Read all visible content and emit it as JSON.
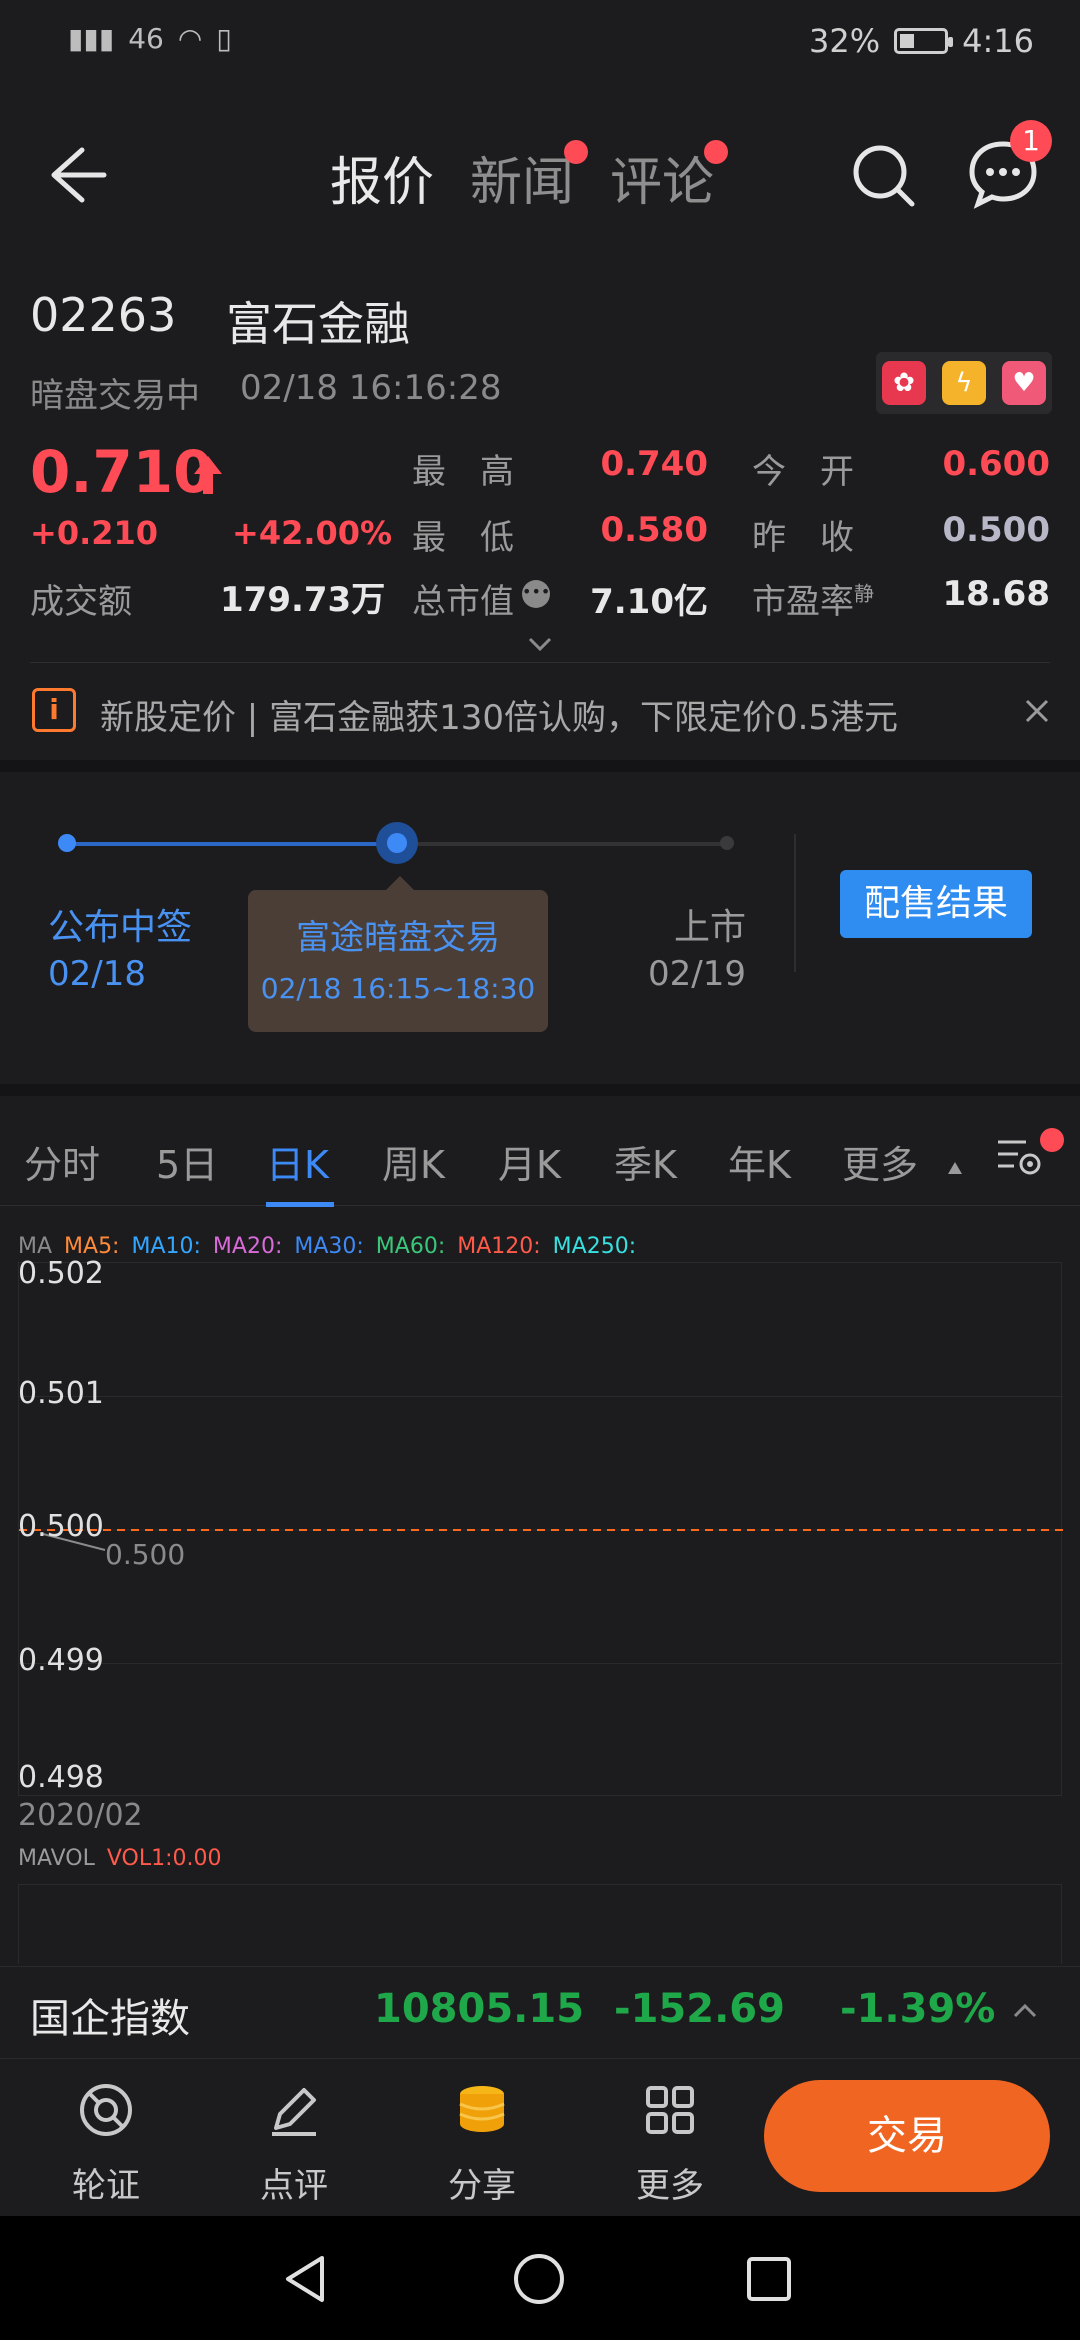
{
  "status_bar": {
    "signal_text": "46",
    "battery_pct": "32%",
    "time": "4:16"
  },
  "header": {
    "tabs": [
      {
        "label": "报价",
        "active": true,
        "dot": false
      },
      {
        "label": "新闻",
        "active": false,
        "dot": true
      },
      {
        "label": "评论",
        "active": false,
        "dot": true
      }
    ],
    "message_badge": "1"
  },
  "stock": {
    "code": "02263",
    "name": "富石金融",
    "status": "暗盘交易中",
    "datetime": "02/18 16:16:28",
    "price": "0.710",
    "change": "+0.210",
    "change_pct": "+42.00%",
    "turnover_label": "成交额",
    "turnover_value": "179.73万",
    "quote": {
      "high_label": "最　高",
      "high_value": "0.740",
      "open_label": "今　开",
      "open_value": "0.600",
      "low_label": "最　低",
      "low_value": "0.580",
      "prev_close_label": "昨　收",
      "prev_close_value": "0.500",
      "mktcap_label": "总市值",
      "mktcap_value": "7.10亿",
      "pe_label": "市盈率",
      "pe_sup": "静",
      "pe_value": "18.68"
    }
  },
  "notice": {
    "icon_text": "i",
    "text": "新股定价 | 富石金融获130倍认购，下限定价0.5港元"
  },
  "timeline": {
    "step1_label": "公布中签",
    "step1_date": "02/18",
    "step2_label": "富途暗盘交易",
    "step2_time": "02/18 16:15~18:30",
    "step3_label": "上市",
    "step3_date": "02/19",
    "result_button": "配售结果"
  },
  "kline_tabs": [
    "分时",
    "5日",
    "日K",
    "周K",
    "月K",
    "季K",
    "年K",
    "更多"
  ],
  "kline_active": "日K",
  "ma_labels": [
    {
      "text": "MA",
      "color": "#8a8a8a"
    },
    {
      "text": "MA5:",
      "color": "#ff8a3a"
    },
    {
      "text": "MA10:",
      "color": "#33a6ff"
    },
    {
      "text": "MA20:",
      "color": "#d86bd8"
    },
    {
      "text": "MA30:",
      "color": "#3d8af7"
    },
    {
      "text": "MA60:",
      "color": "#3ac77a"
    },
    {
      "text": "MA120:",
      "color": "#ff5a4a"
    },
    {
      "text": "MA250:",
      "color": "#39e0e0"
    }
  ],
  "chart_data": {
    "type": "line",
    "y_ticks": [
      "0.502",
      "0.501",
      "0.500",
      "0.499",
      "0.498"
    ],
    "ylim": [
      0.498,
      0.502
    ],
    "x_label": "2020/02",
    "reference_line": {
      "value": 0.5,
      "color": "#ff6a1a"
    },
    "point_label": "0.500",
    "series": []
  },
  "volume": {
    "label": "MAVOL",
    "vol_text": "VOL1:0.00"
  },
  "index_bar": {
    "name": "国企指数",
    "value": "10805.15",
    "change": "-152.69",
    "pct": "-1.39%"
  },
  "toolbar": {
    "items": [
      "轮证",
      "点评",
      "分享",
      "更多"
    ],
    "trade": "交易"
  }
}
